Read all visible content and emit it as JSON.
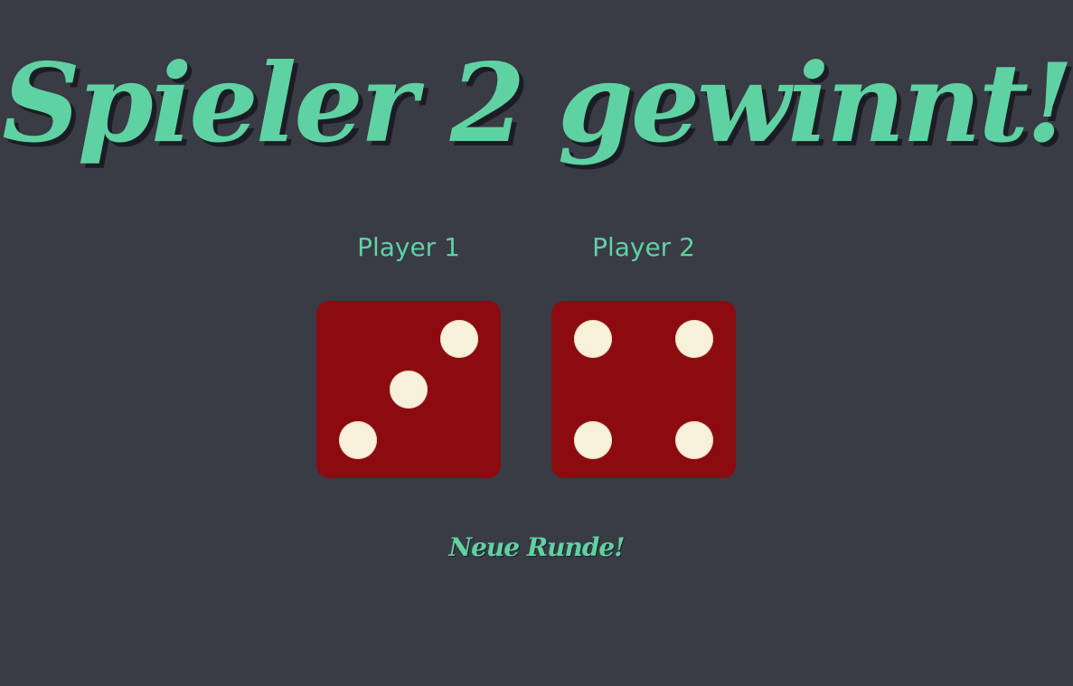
{
  "headline": "Spieler 2 gewinnt!",
  "players": [
    {
      "label": "Player 1",
      "die_value": 3
    },
    {
      "label": "Player 2",
      "die_value": 4
    }
  ],
  "new_round_button": "Neue Runde!",
  "colors": {
    "background": "#393b45",
    "accent": "#5fd2a3",
    "die": "#8c0b11",
    "pip": "#f7f1d9"
  },
  "icons": {
    "die": "die-face-icon",
    "pip": "die-pip-icon"
  }
}
